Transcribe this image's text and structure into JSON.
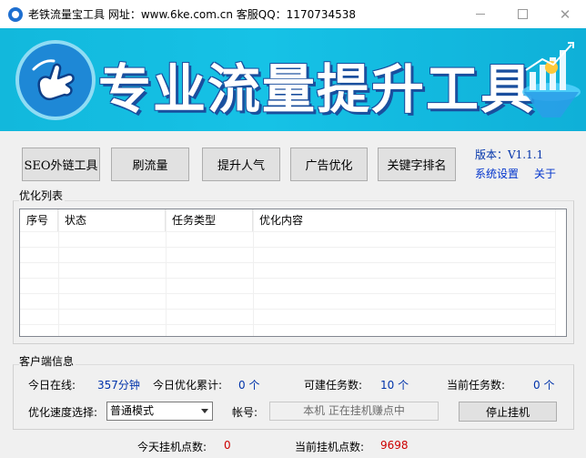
{
  "window": {
    "title": "老铁流量宝工具 网址：www.6ke.com.cn 客服QQ：1170734538",
    "minimize_icon": "minimize-icon",
    "maximize_icon": "maximize-icon",
    "close_symbol": "✕"
  },
  "banner": {
    "title": "专业流量提升工具",
    "logo_icon": "pointing-hand-icon",
    "graphic_icon": "funnel-growth-icon",
    "colors": {
      "background": "#16c2e6",
      "text_shadow": "#1a4f9e"
    }
  },
  "toolbar": {
    "seo_label": "SEO外链工具",
    "flow_label": "刷流量",
    "popularity_label": "提升人气",
    "ad_label": "广告优化",
    "keyword_label": "关键字排名",
    "version": "版本：V1.1.1",
    "settings_link": "系统设置",
    "about_link": "关于"
  },
  "optimize_list": {
    "group_label": "优化列表",
    "columns": [
      "序号",
      "状态",
      "任务类型",
      "优化内容"
    ],
    "rows": []
  },
  "client_info": {
    "group_label": "客户端信息",
    "online_today_label": "今日在线:",
    "online_today_value": "357分钟",
    "optimize_total_label": "今日优化累计:",
    "optimize_total_value": "0 个",
    "can_create_label": "可建任务数:",
    "can_create_value": "10 个",
    "current_tasks_label": "当前任务数:",
    "current_tasks_value": "0 个",
    "speed_label": "优化速度选择:",
    "speed_selected": "普通模式",
    "account_label": "帐号:",
    "account_value": "本机 正在挂机赚点中",
    "stop_button": "停止挂机"
  },
  "footer": {
    "today_points_label": "今天挂机点数:",
    "today_points_value": "0",
    "current_points_label": "当前挂机点数:",
    "current_points_value": "9698"
  }
}
